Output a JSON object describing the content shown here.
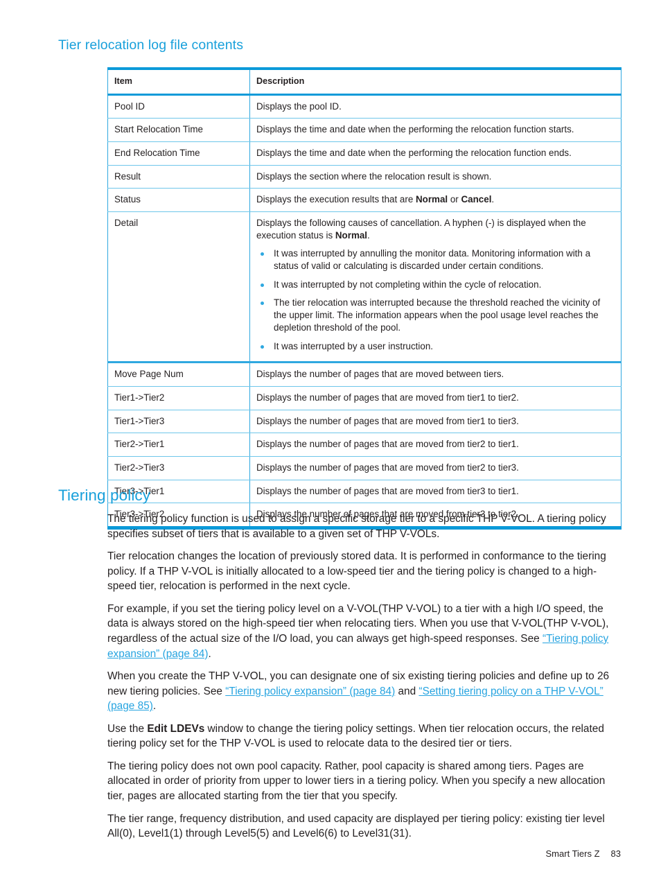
{
  "document": {
    "section_heading": "Tier relocation log file contents",
    "chapter_heading": "Tiering policy"
  },
  "table": {
    "columns": [
      "Item",
      "Description"
    ],
    "rows": [
      {
        "item": "Pool ID",
        "description": "Displays the pool ID."
      },
      {
        "item": "Start Relocation Time",
        "description": "Displays the time and date when the performing the relocation function starts."
      },
      {
        "item": "End Relocation Time",
        "description": "Displays the time and date when the performing the relocation function ends."
      },
      {
        "item": "Result",
        "description": "Displays the section where the relocation result is shown."
      },
      {
        "item": "Status",
        "description_pre": "Displays the execution results that are ",
        "description_b1": "Normal",
        "description_mid": " or ",
        "description_b2": "Cancel",
        "description_post": "."
      },
      {
        "item": "Detail",
        "intro_pre": "Displays the following causes of cancellation. A hyphen (-) is displayed when the execution status is ",
        "intro_bold": "Normal",
        "intro_post": ".",
        "bullets": [
          "It was interrupted by annulling the monitor data. Monitoring information with a status of valid or calculating is discarded under certain conditions.",
          "It was interrupted by not completing within the cycle of relocation.",
          "The tier relocation was interrupted because the threshold reached the vicinity of the upper limit. The information appears when the pool usage level reaches the depletion threshold of the pool.",
          "It was interrupted by a user instruction."
        ]
      },
      {
        "item": "Move Page Num",
        "description": "Displays the number of pages that are moved between tiers."
      },
      {
        "item": "Tier1->Tier2",
        "description": "Displays the number of pages that are moved from tier1 to tier2."
      },
      {
        "item": "Tier1->Tier3",
        "description": "Displays the number of pages that are moved from tier1 to tier3."
      },
      {
        "item": "Tier2->Tier1",
        "description": "Displays the number of pages that are moved from tier2 to tier1."
      },
      {
        "item": "Tier2->Tier3",
        "description": "Displays the number of pages that are moved from tier2 to tier3."
      },
      {
        "item": "Tier3->Tier1",
        "description": "Displays the number of pages that are moved from tier3 to tier1."
      },
      {
        "item": "Tier3->Tier2",
        "description": "Displays the number of pages that are moved from tier3 to tier2."
      }
    ]
  },
  "tiering_policy": {
    "p1": "The tiering policy function is used to assign a specific storage tier to a specific THP V-VOL. A tiering policy specifies subset of tiers that is available to a given set of THP V-VOLs.",
    "p2": "Tier relocation changes the location of previously stored data. It is performed in conformance to the tiering policy. If a THP V-VOL is initially allocated to a low-speed tier and the tiering policy is changed to a high-speed tier, relocation is performed in the next cycle.",
    "p3_pre": "For example, if you set the tiering policy level on a V-VOL(THP V-VOL) to a tier with a high I/O speed, the data is always stored on the high-speed tier when relocating tiers. When you use that V-VOL(THP V-VOL), regardless of the actual size of the I/O load, you can always get high-speed responses. See ",
    "p3_link": "“Tiering policy expansion” (page 84)",
    "p3_post": ".",
    "p4_pre": "When you create the THP V-VOL, you can designate one of six existing tiering policies and define up to 26 new tiering policies. See ",
    "p4_link1": "“Tiering policy expansion” (page 84)",
    "p4_mid": " and ",
    "p4_link2": "“Setting tiering policy on a THP V-VOL” (page 85)",
    "p4_post": ".",
    "p5_pre": "Use the ",
    "p5_bold": "Edit LDEVs",
    "p5_post": " window to change the tiering policy settings. When tier relocation occurs, the related tiering policy set for the THP V-VOL is used to relocate data to the desired tier or tiers.",
    "p6": "The tiering policy does not own pool capacity. Rather, pool capacity is shared among tiers. Pages are allocated in order of priority from upper to lower tiers in a tiering policy. When you specify a new allocation tier, pages are allocated starting from the tier that you specify.",
    "p7": "The tier range, frequency distribution, and used capacity are displayed per tiering policy: existing tier level All(0), Level1(1) through Level5(5) and Level6(6) to Level31(31)."
  },
  "footer": {
    "title": "Smart Tiers Z",
    "page_number": "83"
  },
  "colors": {
    "accent_blue": "#18a0db",
    "link_blue": "#27a4e0",
    "table_border": "#2ea8e0",
    "text": "#231f20"
  }
}
